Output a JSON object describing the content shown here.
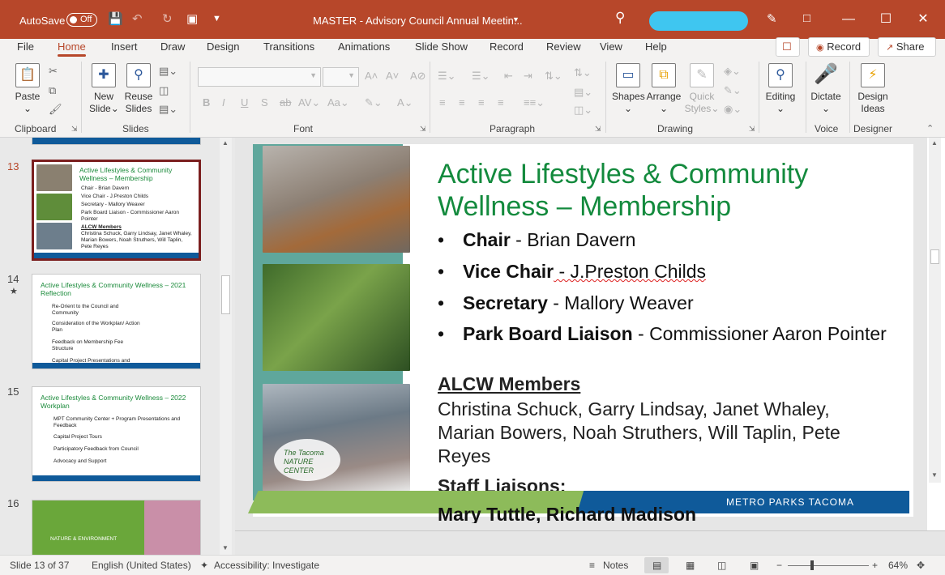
{
  "title_bar": {
    "autosave_label": "AutoSave",
    "autosave_state": "Off",
    "document_title": "MASTER - Advisory Council Annual Meetin...",
    "accent_color": "#b7472a"
  },
  "menu": {
    "tabs": [
      "File",
      "Home",
      "Insert",
      "Draw",
      "Design",
      "Transitions",
      "Animations",
      "Slide Show",
      "Record",
      "Review",
      "View",
      "Help"
    ],
    "active_tab": "Home",
    "record_label": "Record",
    "share_label": "Share"
  },
  "ribbon": {
    "clipboard": {
      "label": "Clipboard",
      "paste": "Paste"
    },
    "slides": {
      "label": "Slides",
      "new_slide_1": "New",
      "new_slide_2": "Slide",
      "reuse_1": "Reuse",
      "reuse_2": "Slides"
    },
    "font": {
      "label": "Font"
    },
    "paragraph": {
      "label": "Paragraph"
    },
    "drawing": {
      "label": "Drawing",
      "shapes": "Shapes",
      "arrange": "Arrange",
      "quick_styles_1": "Quick",
      "quick_styles_2": "Styles"
    },
    "editing": {
      "label": "Editing"
    },
    "voice": {
      "label": "Voice",
      "dictate": "Dictate"
    },
    "designer": {
      "label": "Designer",
      "design_ideas_1": "Design",
      "design_ideas_2": "Ideas"
    }
  },
  "thumbnails": [
    {
      "number": "13",
      "title": "Active Lifestyles & Community Wellness – Membership",
      "lines": [
        "Chair - Brian Davern",
        "Vice Chair - J.Preston Childs",
        "Secretary - Mallory Weaver",
        "Park Board Liaison - Commissioner Aaron Pointer",
        "ALCW Members",
        "Christina Schuck, Garry Lindsay, Janet Whaley, Marian Bowers, Noah Struthers, Will Taplin, Pete Reyes"
      ],
      "footer": "METRO PARKS TACOMA"
    },
    {
      "number": "14",
      "star": "★",
      "title": "Active Lifestyles & Community Wellness – 2021 Reflection",
      "lines": [
        "Re-Orient to the Council and Community",
        "Consideration of the Workplan/ Action Plan",
        "Feedback on Membership Fee Structure",
        "Capital Project Presentations and"
      ],
      "footer": "METRO PARKS TACOMA"
    },
    {
      "number": "15",
      "title": "Active Lifestyles & Community Wellness – 2022 Workplan",
      "lines": [
        "MPT Community Center + Program Presentations and Feedback",
        "Capital Project Tours",
        "Participatory Feedback from Council",
        "Advocacy and Support"
      ],
      "footer": "METRO PARKS TACOMA"
    },
    {
      "number": "16",
      "title": "NATURE & ENVIRONMENT"
    }
  ],
  "slide": {
    "title": "Active Lifestyles & Community Wellness – Membership",
    "bullets": [
      {
        "role": "Chair",
        "name": " - Brian Davern"
      },
      {
        "role": "Vice Chair",
        "name": " - J.Preston Childs"
      },
      {
        "role": "Secretary",
        "name": " - Mallory Weaver"
      },
      {
        "role": "Park Board Liaison",
        "name": " - Commissioner Aaron Pointer"
      }
    ],
    "members_heading": "ALCW Members",
    "members_text": "Christina Schuck, Garry Lindsay, Janet Whaley, Marian Bowers, Noah Struthers, Will Taplin, Pete Reyes",
    "staff_heading": "Staff Liaisons:",
    "staff_text": "Mary Tuttle, Richard Madison",
    "footer": "METRO PARKS TACOMA",
    "photo_sign": "The Tacoma NATURE CENTER",
    "title_color": "#138a3d",
    "footer_green": "#8dbb5a",
    "footer_blue": "#0f5a9a"
  },
  "status": {
    "slide_counter": "Slide 13 of 37",
    "language": "English (United States)",
    "accessibility": "Accessibility: Investigate",
    "notes": "Notes",
    "zoom": "64%"
  }
}
